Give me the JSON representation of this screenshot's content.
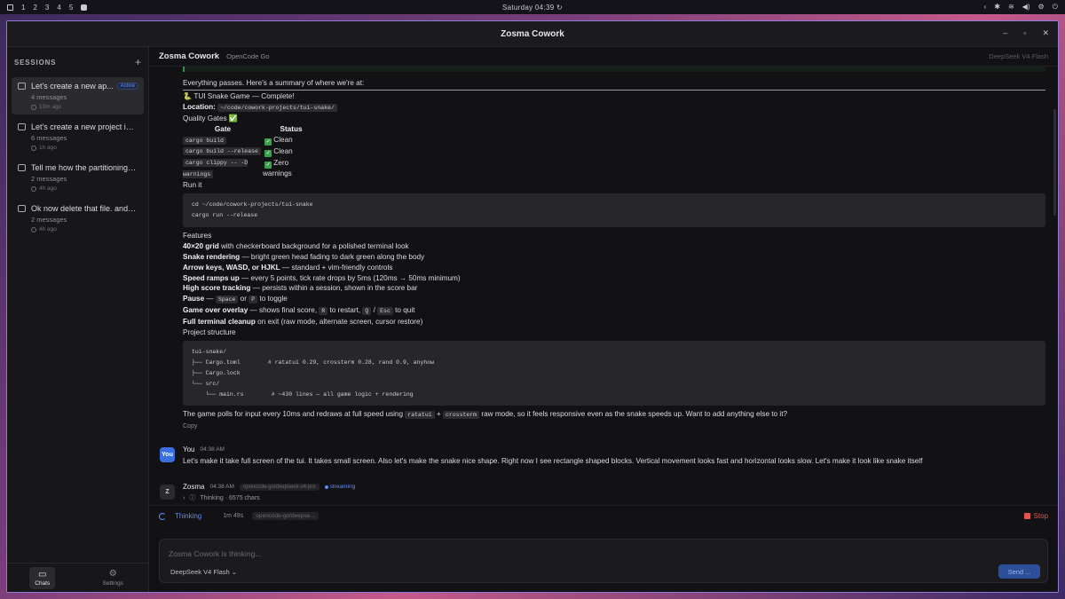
{
  "sysbar": {
    "workspaces": [
      "1",
      "2",
      "3",
      "4",
      "5"
    ],
    "clock": "Saturday 04:39",
    "refresh_icon": "↻",
    "tray": [
      "‹",
      "✱",
      "≋",
      "◀)",
      "⚙",
      "⏻"
    ]
  },
  "window": {
    "title": "Zosma Cowork",
    "controls": [
      "–",
      "▫",
      "✕"
    ]
  },
  "sidebar": {
    "heading": "SESSIONS",
    "new_icon": "+",
    "sessions": [
      {
        "title": "Let's create a new ap...",
        "badge": "Active",
        "messages": "4 messages",
        "time": "10m ago"
      },
      {
        "title": "Let's create a new project ins...",
        "messages": "6 messages",
        "time": "1h ago"
      },
      {
        "title": "Tell me how the partitioning i...",
        "messages": "2 messages",
        "time": "4h ago"
      },
      {
        "title": "Ok now delete that file. and l...",
        "messages": "2 messages",
        "time": "4h ago"
      }
    ],
    "tabs": [
      {
        "label": "Chats",
        "icon": "chat-icon"
      },
      {
        "label": "Settings",
        "icon": "gear-icon"
      }
    ]
  },
  "header": {
    "app": "Zosma Cowork",
    "provider": "OpenCode Go",
    "model": "DeepSeek V4 Flash"
  },
  "assistant_reply": {
    "intro": "Everything passes. Here's a summary of where we're at:",
    "heading": "🐍 TUI Snake Game — Complete!",
    "location_label": "Location:",
    "location_value": "~/code/cowork-projects/tui-snake/",
    "quality_heading": "Quality Gates ✅",
    "gates_headers": [
      "Gate",
      "Status"
    ],
    "gates": [
      {
        "gate": "cargo build",
        "status": "Clean"
      },
      {
        "gate": "cargo build --release",
        "status": "Clean"
      },
      {
        "gate": "cargo clippy -- -D warnings",
        "status": "Zero warnings"
      }
    ],
    "run_heading": "Run it",
    "run_code": [
      "cd ~/code/cowork-projects/tui-snake",
      "cargo run --release"
    ],
    "features_heading": "Features",
    "features": [
      {
        "bold": "40×20 grid",
        "rest": " with checkerboard background for a polished terminal look"
      },
      {
        "bold": "Snake rendering",
        "rest": " — bright green head fading to dark green along the body"
      },
      {
        "bold": "Arrow keys, WASD, or HJKL",
        "rest": " — standard + vim-friendly controls"
      },
      {
        "bold": "Speed ramps up",
        "rest": " — every 5 points, tick rate drops by 5ms (120ms → 50ms minimum)"
      },
      {
        "bold": "High score tracking",
        "rest": " — persists within a session, shown in the score bar"
      }
    ],
    "pause": {
      "bold": "Pause",
      "dash": " — ",
      "k1": "Space",
      "or": " or ",
      "k2": "P",
      "tail": " to toggle"
    },
    "gameover": {
      "bold": "Game over overlay",
      "text1": " — shows final score, ",
      "k1": "R",
      "text2": " to restart, ",
      "k2": "Q",
      "slash": " / ",
      "k3": "Esc",
      "text3": " to quit"
    },
    "cleanup": {
      "bold": "Full terminal cleanup",
      "rest": " on exit (raw mode, alternate screen, cursor restore)"
    },
    "structure_heading": "Project structure",
    "structure_code": [
      "tui-snake/",
      "├── Cargo.toml        # ratatui 0.29, crossterm 0.28, rand 0.9, anyhow",
      "├── Cargo.lock",
      "└── src/",
      "    └── main.rs        # ~430 lines — all game logic + rendering"
    ],
    "closing": {
      "text1": "The game polls for input every 10ms and redraws at full speed using ",
      "k1": "ratatui",
      "plus": " + ",
      "k2": "crossterm",
      "text2": " raw mode, so it feels responsive even as the snake speeds up. Want to add anything else to it?"
    },
    "copy_label": "Copy"
  },
  "user_message": {
    "avatar": "You",
    "name": "You",
    "time": "04:38 AM",
    "text": "Let's make it take full screen of the tui. It takes small screen. Also let's make the snake nice shape. Right now I see rectangle shaped blocks. Vertical movement looks fast and horizontal looks slow. Let's make it look like snake itself"
  },
  "zosma_message": {
    "avatar": "Z",
    "name": "Zosma",
    "time": "04:38 AM",
    "model_pill": "opencode-go/deepseek-v4-pro",
    "streaming": "streaming",
    "thinking": "Thinking · 6575 chars"
  },
  "status": {
    "label": "Thinking",
    "elapsed": "1m 49s",
    "model_pill": "opencode-go/deepse...",
    "stop": "Stop"
  },
  "composer": {
    "placeholder": "Zosma Cowork is thinking...",
    "model_select": "DeepSeek V4 Flash ⌄",
    "send": "Send ..."
  }
}
